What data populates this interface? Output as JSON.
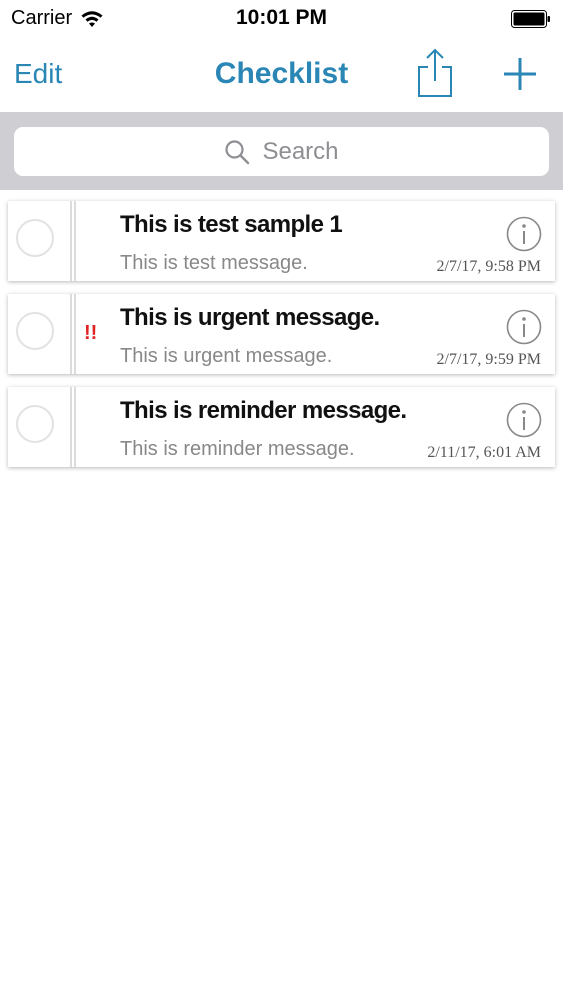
{
  "status_bar": {
    "carrier": "Carrier",
    "time": "10:01 PM",
    "wifi_icon": "wifi-icon",
    "battery_icon": "battery-icon"
  },
  "nav": {
    "edit_label": "Edit",
    "title": "Checklist",
    "share_icon": "share-icon",
    "add_icon": "plus-icon",
    "accent_color": "#2a86b5"
  },
  "search": {
    "placeholder": "Search",
    "icon": "search-icon"
  },
  "items": [
    {
      "title": "This is test sample 1",
      "message": "This is test message.",
      "timestamp": "2/7/17, 9:58 PM",
      "priority": ""
    },
    {
      "title": "This is urgent message.",
      "message": "This is urgent message.",
      "timestamp": "2/7/17, 9:59 PM",
      "priority": "!!"
    },
    {
      "title": "This is reminder message.",
      "message": "This is reminder message.",
      "timestamp": "2/11/17, 6:01 AM",
      "priority": ""
    }
  ],
  "colors": {
    "priority": "#e02424",
    "search_bar_background": "#cfcfd3"
  }
}
